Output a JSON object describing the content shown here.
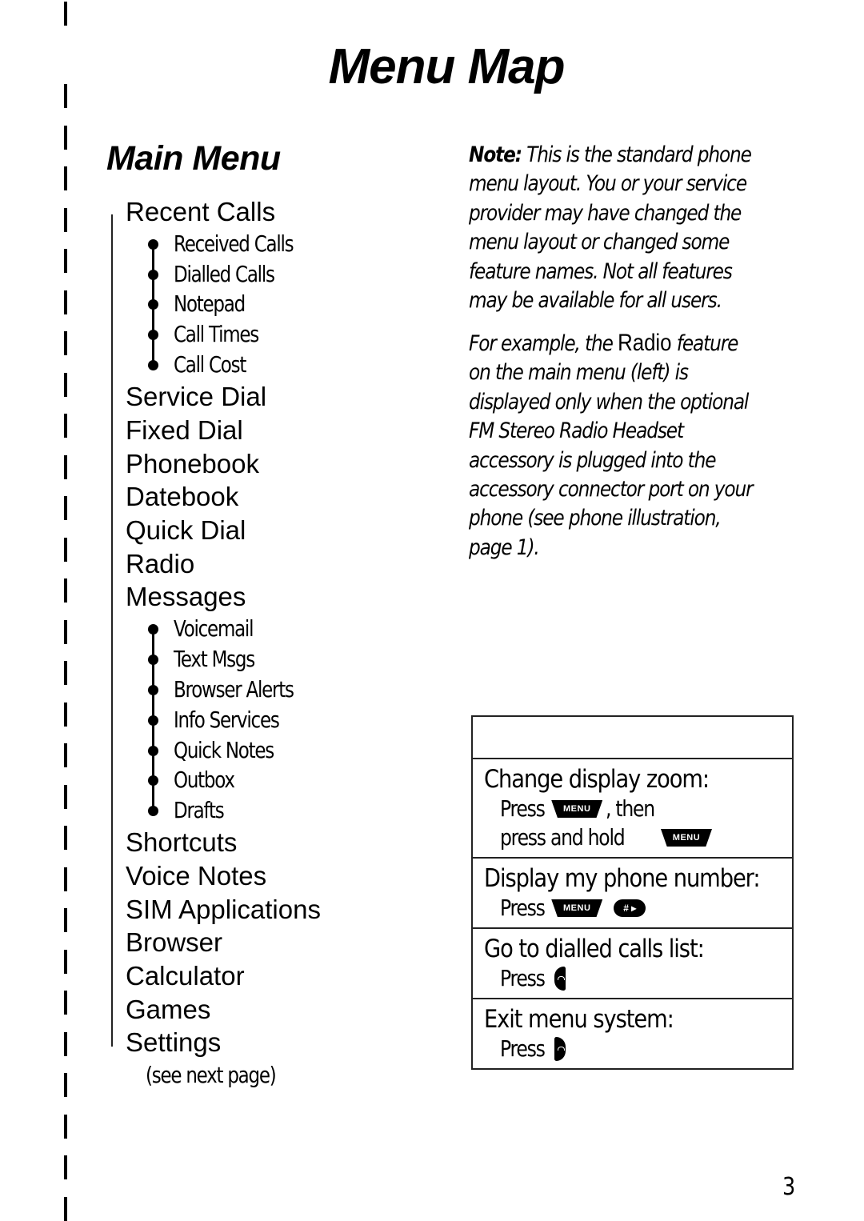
{
  "page": {
    "title": "Menu Map",
    "page_number": "3"
  },
  "main_menu": {
    "title": "Main Menu",
    "items": [
      {
        "label": "Recent Calls",
        "children": [
          "Received Calls",
          "Dialled Calls",
          "Notepad",
          "Call Times",
          "Call Cost"
        ]
      },
      {
        "label": "Service Dial"
      },
      {
        "label": "Fixed Dial"
      },
      {
        "label": "Phonebook"
      },
      {
        "label": "Datebook"
      },
      {
        "label": "Quick Dial"
      },
      {
        "label": "Radio"
      },
      {
        "label": "Messages",
        "children": [
          "Voicemail",
          "Text Msgs",
          "Browser Alerts",
          "Info Services",
          "Quick Notes",
          "Outbox",
          "Drafts"
        ]
      },
      {
        "label": "Shortcuts"
      },
      {
        "label": "Voice Notes"
      },
      {
        "label": "SIM Applications"
      },
      {
        "label": "Browser"
      },
      {
        "label": "Calculator"
      },
      {
        "label": "Games"
      },
      {
        "label": "Settings"
      }
    ],
    "see_next": "(see next page)"
  },
  "notes": {
    "note_label": "Note:",
    "note_lines": [
      " This is the standard phone",
      "menu layout. You or your service",
      "provider may have changed the",
      "menu layout or changed some",
      "feature names. Not all features",
      "may be available for all users."
    ],
    "example_prefix": "For example, the ",
    "example_feature": "Radio",
    "example_suffix": " feature",
    "example_lines": [
      "on the main menu (left) is",
      "displayed only when the optional",
      "FM Stereo Radio Headset",
      "accessory is plugged into the",
      "accessory connector port on your",
      "phone (see phone illustration,",
      "page 1)."
    ]
  },
  "shortcuts": {
    "header": "",
    "rows": [
      {
        "label": "Change display zoom:",
        "press": "Press",
        "then": ", then",
        "line2": "press and hold",
        "key": "MENU"
      },
      {
        "label": "Display my phone number:",
        "press": "Press",
        "key": "MENU",
        "key2": "# ▸"
      },
      {
        "label": "Go to dialled calls list:",
        "press": "Press",
        "key": "send-key"
      },
      {
        "label": "Exit menu system:",
        "press": "Press",
        "key": "end-key"
      }
    ],
    "menu_key_label": "MENU",
    "hash_key_label": "# ▸"
  }
}
